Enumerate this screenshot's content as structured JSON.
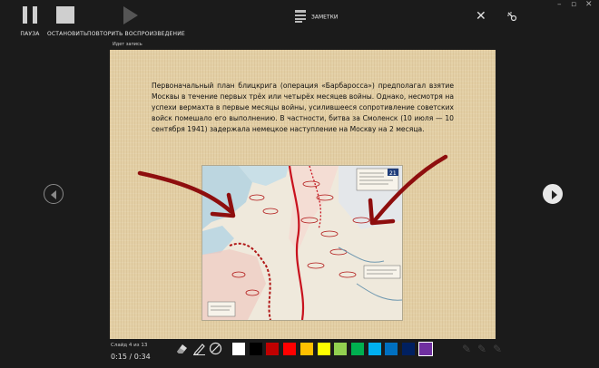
{
  "toolbar": {
    "pause_label": "ПАУЗА",
    "stop_label": "ОСТАНОВИТЬ",
    "replay_label": "ПОВТОРИТЬ ВОСПРОИЗВЕДЕНИЕ",
    "notes_label": "ЗАМЕТКИ"
  },
  "recording_label": "Идет запись",
  "slide": {
    "body_text": "Первоначальный план блицкрига (операция «Барбаросса») предполагал взятие Москвы в течение первых трёх или четырёх месяцев войны. Однако, несмотря на успехи вермахта в первые месяцы войны, усилившееся сопротивление советских войск помешало его выполнению. В частности, битва за Смоленск (10 июля — 10 сентября 1941) задержала немецкое наступление на Москву на 2 месяца.",
    "map_number": "21"
  },
  "footer": {
    "slide_counter": "Слайд 4 из 13",
    "timer": "0:15 / 0:34"
  },
  "pen_colors": [
    "#ffffff",
    "#000000",
    "#c00000",
    "#ff0000",
    "#ffc000",
    "#ffff00",
    "#92d050",
    "#00b050",
    "#00b0f0",
    "#0070c0",
    "#002060",
    "#7030a0"
  ],
  "icons": {
    "pause": "pause-icon",
    "stop": "stop-icon",
    "replay": "play-icon",
    "notes": "notes-icon",
    "close": "close-icon",
    "effects": "effects-icon",
    "eraser": "eraser-icon",
    "pen": "pen-icon",
    "highlighter": "highlighter-icon"
  }
}
